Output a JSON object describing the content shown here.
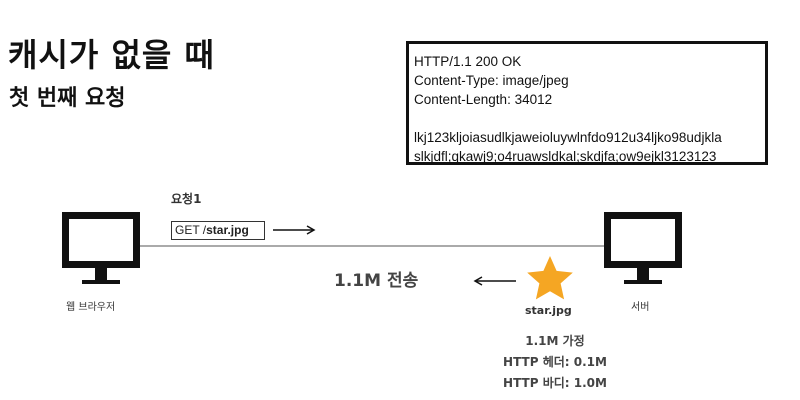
{
  "heading": {
    "title": "캐시가 없을 때",
    "subtitle": "첫 번째 요청"
  },
  "response": {
    "lines": [
      "HTTP/1.1 200 OK",
      "Content-Type: image/jpeg",
      "Content-Length: 34012",
      "",
      "lkj123kljoiasudlkjaweioluywlnfdo912u34ljko98udjkla",
      "slkjdfl;qkawj9;o4ruawsldkal;skdjfa;ow9ejkl3123123"
    ]
  },
  "request": {
    "label": "요청1",
    "method": "GET /",
    "path": "star.jpg"
  },
  "transfer_label": "1.1M 전송",
  "client_label": "웹 브라우저",
  "server_label": "서버",
  "resource": {
    "name": "star.jpg",
    "notes": [
      "1.1M 가정",
      "HTTP 헤더: 0.1M",
      "HTTP 바디: 1.0M"
    ],
    "star_color": "#f5a623"
  }
}
